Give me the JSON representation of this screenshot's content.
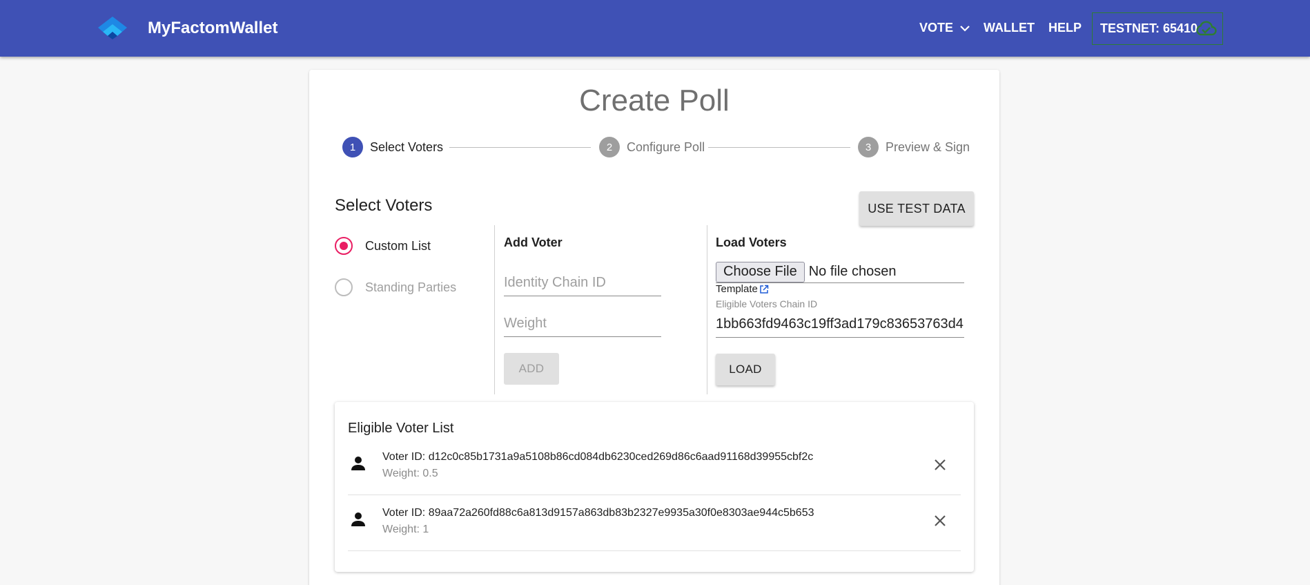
{
  "header": {
    "brand": "MyFactomWallet",
    "nav": {
      "vote": "VOTE",
      "wallet": "WALLET",
      "help": "HELP"
    },
    "network_status": "TESTNET: 65410",
    "colors": {
      "bar": "#3f51b5",
      "network_border": "#2e7d32",
      "cloud_icon": "#2e7d32"
    }
  },
  "page": {
    "title": "Create Poll",
    "steps": [
      {
        "number": "1",
        "label": "Select Voters",
        "state": "active"
      },
      {
        "number": "2",
        "label": "Configure Poll",
        "state": "inactive"
      },
      {
        "number": "3",
        "label": "Preview & Sign",
        "state": "inactive"
      }
    ]
  },
  "select_voters": {
    "title": "Select Voters",
    "use_test_data_label": "USE TEST DATA",
    "options": [
      {
        "label": "Custom List",
        "checked": true
      },
      {
        "label": "Standing Parties",
        "checked": false
      }
    ],
    "add_voter": {
      "title": "Add Voter",
      "identity_placeholder": "Identity Chain ID",
      "weight_placeholder": "Weight",
      "add_label": "ADD"
    },
    "load_voters": {
      "title": "Load Voters",
      "choose_file_label": "Choose File",
      "file_status": "No file chosen",
      "template_label": "Template",
      "chain_id_label": "Eligible Voters Chain ID",
      "chain_id_value": "1bb663fd9463c19ff3ad179c83653763d4",
      "load_label": "LOAD"
    }
  },
  "eligible_list": {
    "title": "Eligible Voter List",
    "voters": [
      {
        "id_text": "Voter ID: d12c0c85b1731a9a5108b86cd084db6230ced269d86c6aad91168d39955cbf2c",
        "weight_text": "Weight: 0.5"
      },
      {
        "id_text": "Voter ID: 89aa72a260fd88c6a813d9157a863db83b2327e9935a30f0e8303ae944c5b653",
        "weight_text": "Weight: 1"
      }
    ]
  },
  "colors": {
    "accent": "#e91e63",
    "primary": "#3f51b5"
  }
}
